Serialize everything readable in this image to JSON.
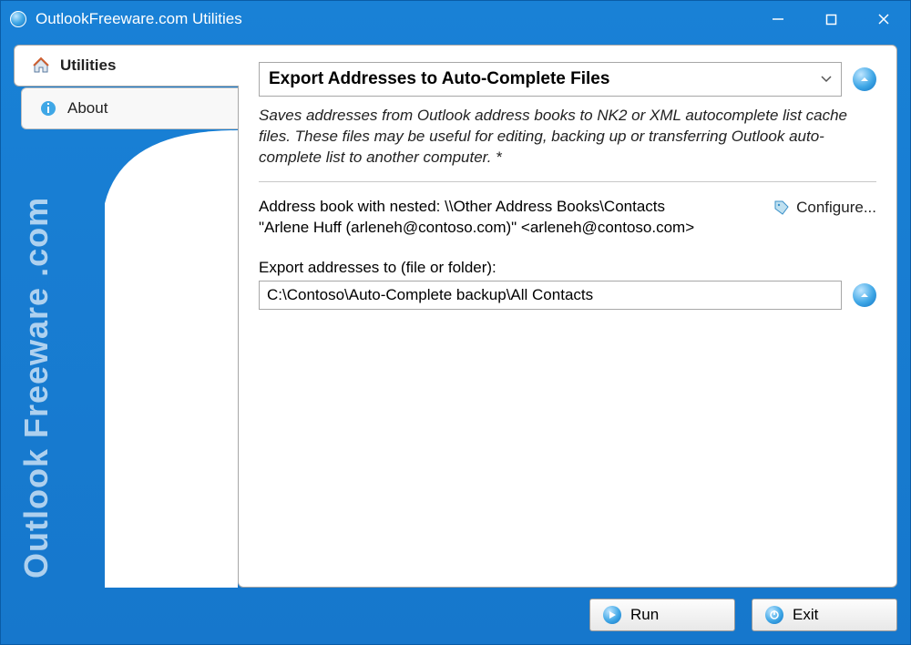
{
  "window": {
    "title": "OutlookFreeware.com Utilities"
  },
  "sidebar": {
    "tabs": [
      {
        "label": "Utilities"
      },
      {
        "label": "About"
      }
    ],
    "brand": "Outlook Freeware .com"
  },
  "main": {
    "utility_dropdown": "Export Addresses to Auto-Complete Files",
    "description": "Saves addresses from Outlook address books to NK2 or XML autocomplete list cache files. These files may be useful for editing, backing up or transferring Outlook auto-complete list to another computer. *",
    "address_info": "Address book with nested: \\\\Other Address Books\\Contacts\n\"Arlene Huff (arleneh@contoso.com)\" <arleneh@contoso.com>",
    "configure_label": "Configure...",
    "export_label": "Export addresses to (file or folder):",
    "export_path": "C:\\Contoso\\Auto-Complete backup\\All Contacts"
  },
  "footer": {
    "run_label": "Run",
    "exit_label": "Exit"
  }
}
